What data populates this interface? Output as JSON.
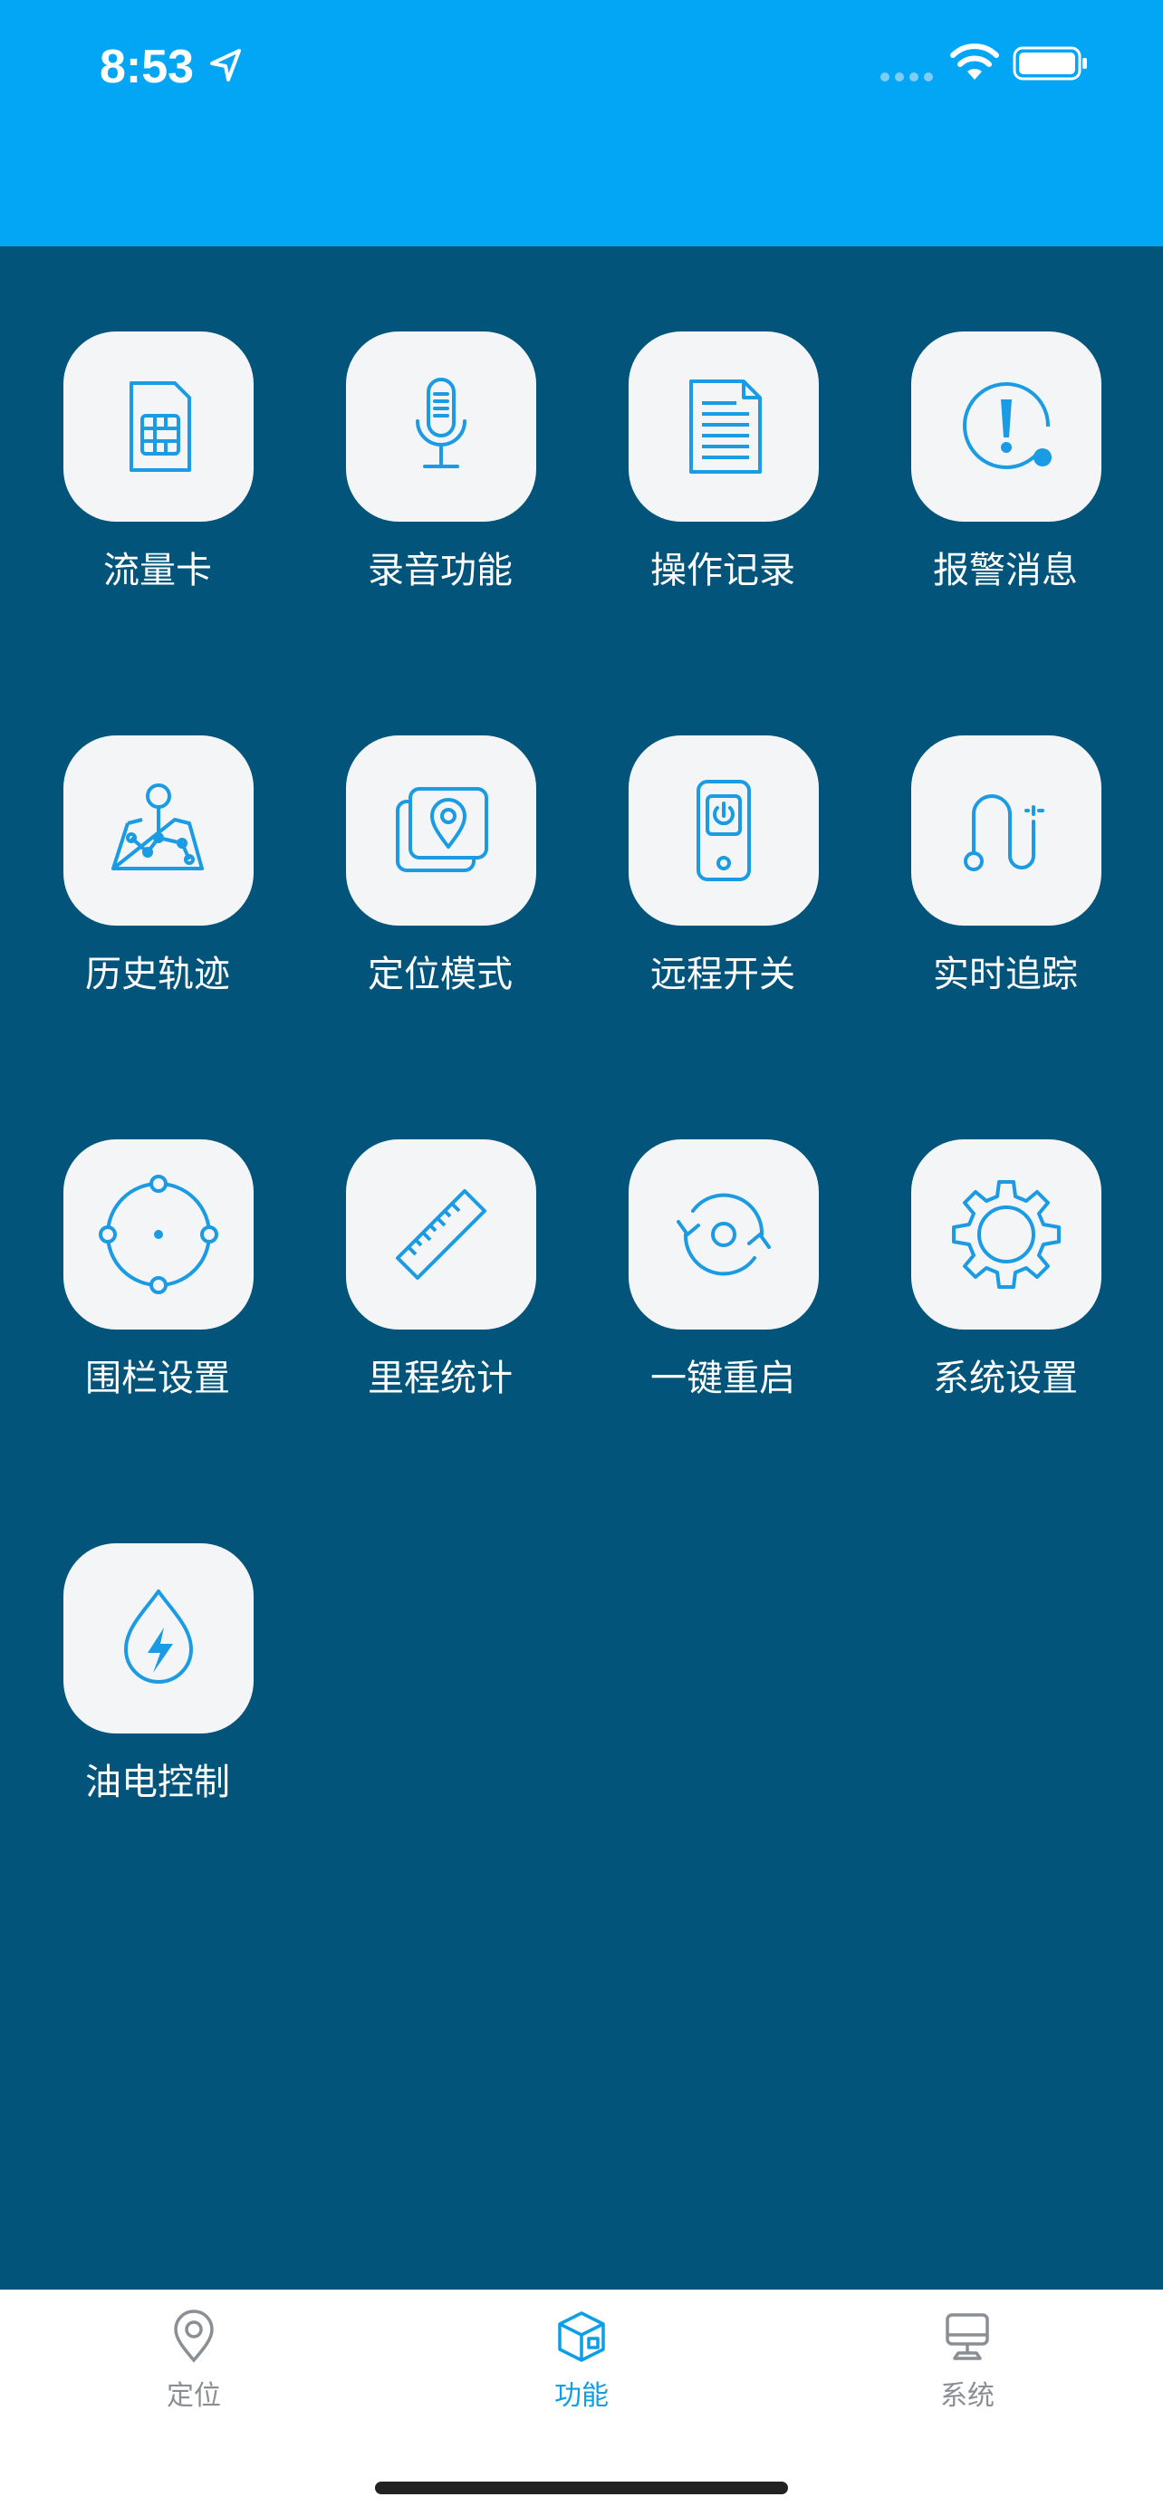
{
  "status_bar": {
    "time": "8:53",
    "location_icon": "location-arrow-icon",
    "signal_icon": "cellular-signal-icon",
    "wifi_icon": "wifi-icon",
    "battery_icon": "battery-full-icon",
    "background_color": "#02a6f5"
  },
  "colors": {
    "content_background": "#02547a",
    "tile_background": "#f4f5f6",
    "icon_stroke": "#1a9be3",
    "tab_active": "#0d9ee8",
    "tab_inactive": "#8a8f94"
  },
  "features": [
    {
      "label": "流量卡",
      "icon": "sim-card-icon"
    },
    {
      "label": "录音功能",
      "icon": "microphone-icon"
    },
    {
      "label": "操作记录",
      "icon": "document-icon"
    },
    {
      "label": "报警消息",
      "icon": "alert-icon"
    },
    {
      "label": "历史轨迹",
      "icon": "route-map-icon"
    },
    {
      "label": "定位模式",
      "icon": "location-mode-icon"
    },
    {
      "label": "远程开关",
      "icon": "remote-power-icon"
    },
    {
      "label": "实时追踪",
      "icon": "tracking-path-icon"
    },
    {
      "label": "围栏设置",
      "icon": "fence-icon"
    },
    {
      "label": "里程统计",
      "icon": "ruler-icon"
    },
    {
      "label": "一键重启",
      "icon": "restart-icon"
    },
    {
      "label": "系统设置",
      "icon": "gear-icon"
    },
    {
      "label": "油电控制",
      "icon": "power-drop-icon"
    }
  ],
  "tab_bar": {
    "tabs": [
      {
        "label": "定位",
        "icon": "location-pin-icon",
        "active": false
      },
      {
        "label": "功能",
        "icon": "cube-icon",
        "active": true
      },
      {
        "label": "系统",
        "icon": "monitor-icon",
        "active": false
      }
    ]
  }
}
